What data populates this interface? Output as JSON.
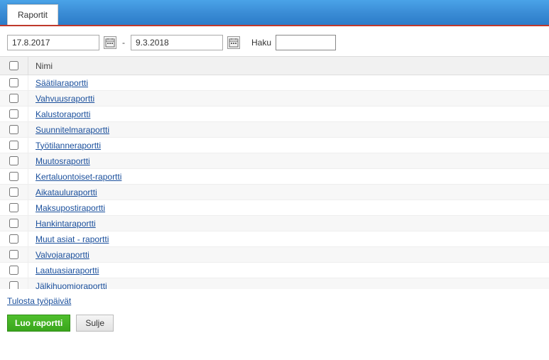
{
  "tab": {
    "label": "Raportit"
  },
  "filters": {
    "date_from": "17.8.2017",
    "date_to": "9.3.2018",
    "search_label": "Haku",
    "search_value": ""
  },
  "table": {
    "header": {
      "name": "Nimi"
    },
    "rows": [
      {
        "name": "Säätilaraportti"
      },
      {
        "name": "Vahvuusraportti"
      },
      {
        "name": "Kalustoraportti"
      },
      {
        "name": "Suunnitelmaraportti"
      },
      {
        "name": "Työtilanneraportti"
      },
      {
        "name": "Muutosraportti"
      },
      {
        "name": "Kertaluontoiset-raportti"
      },
      {
        "name": "Aikatauluraportti"
      },
      {
        "name": "Maksupostiraportti"
      },
      {
        "name": "Hankintaraportti"
      },
      {
        "name": "Muut asiat - raportti"
      },
      {
        "name": "Valvojaraportti"
      },
      {
        "name": "Laatuasiaraportti"
      },
      {
        "name": "Jälkihuomioraportti"
      }
    ]
  },
  "footer": {
    "link_label": "Tulosta työpäivät",
    "btn_primary": "Luo raportti",
    "btn_secondary": "Sulje"
  }
}
